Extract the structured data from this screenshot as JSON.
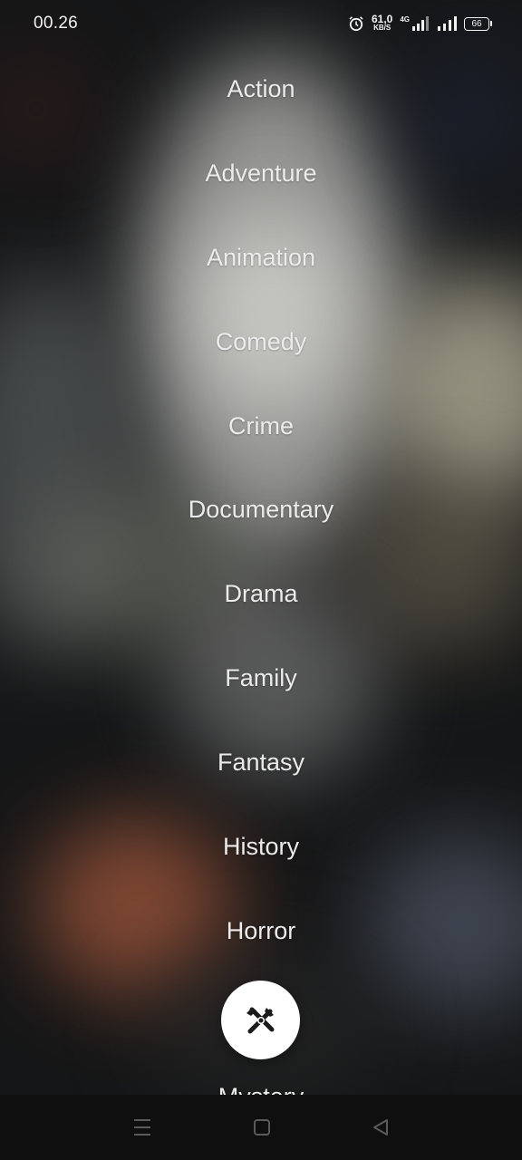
{
  "status_bar": {
    "time": "00.26",
    "net_speed_value": "61,0",
    "net_speed_unit": "KB/S",
    "network_type": "4G",
    "battery_level": "66"
  },
  "genres": [
    "Action",
    "Adventure",
    "Animation",
    "Comedy",
    "Crime",
    "Documentary",
    "Drama",
    "Family",
    "Fantasy",
    "History",
    "Horror",
    "Mystery"
  ],
  "fab": {
    "icon": "crossed-tools-icon"
  },
  "nav_bar": {
    "icons": [
      "menu-icon",
      "home-square-icon",
      "back-triangle-icon"
    ]
  }
}
